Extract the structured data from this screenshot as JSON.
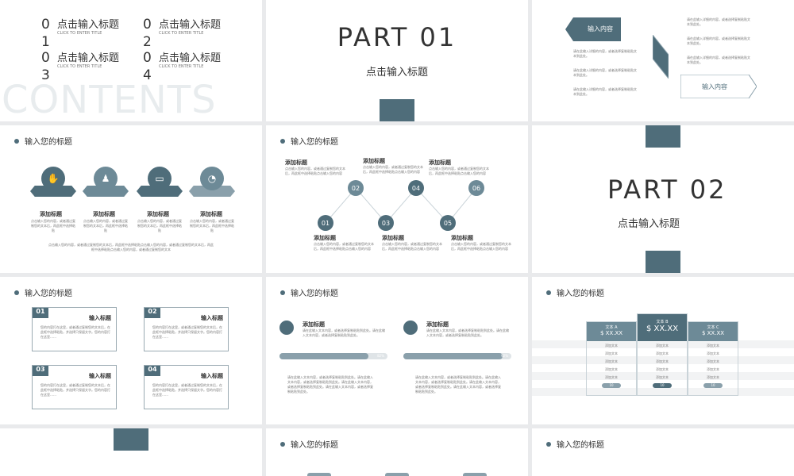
{
  "colors": {
    "accent": "#4f6d7a",
    "accent_light": "#8aa0ab",
    "bg": "#e9eaec"
  },
  "slide1": {
    "items": [
      {
        "num": "01",
        "title": "点击输入标题",
        "sub": "CLICK TO ENTER TITLE"
      },
      {
        "num": "02",
        "title": "点击输入标题",
        "sub": "CLICK TO ENTER TITLE"
      },
      {
        "num": "03",
        "title": "点击输入标题",
        "sub": "CLICK TO ENTER TITLE"
      },
      {
        "num": "04",
        "title": "点击输入标题",
        "sub": "CLICK TO ENTER TITLE"
      }
    ],
    "watermark": "CONTENTS"
  },
  "slide2": {
    "part": "PART 01",
    "title": "点击输入标题"
  },
  "slide3": {
    "left_label": "输入内容",
    "right_label": "输入内容",
    "bullet": "请在此输入详细的内容，或者选择复制粘贴文本到此处。"
  },
  "slide4": {
    "header": "输入您的标题",
    "items": [
      {
        "title": "添加标题",
        "text": "点击输入您的内容，或者通过复制您的文本后，再此框中选择粘贴"
      },
      {
        "title": "添加标题",
        "text": "点击输入您的内容，或者通过复制您的文本后，再此框中选择粘贴"
      },
      {
        "title": "添加标题",
        "text": "点击输入您的内容，或者通过复制您的文本后，再此框中选择粘贴"
      },
      {
        "title": "添加标题",
        "text": "点击输入您的内容，或者通过复制您的文本后，再此框中选择粘贴"
      }
    ],
    "footer": "点击输入您的内容，或者通过复制您的文本后，再此框中选择粘贴点击输入您的内容，或者通过复制您的文本后，再此框中选择粘贴点击输入您的内容，或者通过复制您的文本"
  },
  "slide5": {
    "header": "输入您的标题",
    "nodes": [
      "01",
      "02",
      "03",
      "04",
      "05",
      "06"
    ],
    "item_title": "添加标题",
    "item_text": "点击输入您的内容，或者通过复制您的文本后，再此框中选择粘贴点击输入您的内容"
  },
  "slide6": {
    "part": "PART 02",
    "title": "点击输入标题"
  },
  "slide7": {
    "header": "输入您的标题",
    "boxes": [
      {
        "num": "01",
        "title": "输入标题",
        "text": "您的内容打在这里，或者通过复制您的文本后，在此框中选择粘贴，并选择只保留文字。您的内容打在这里……"
      },
      {
        "num": "02",
        "title": "输入标题",
        "text": "您的内容打在这里，或者通过复制您的文本后，在此框中选择粘贴，并选择只保留文字。您的内容打在这里……"
      },
      {
        "num": "03",
        "title": "输入标题",
        "text": "您的内容打在这里，或者通过复制您的文本后，在此框中选择粘贴，并选择只保留文字。您的内容打在这里……"
      },
      {
        "num": "04",
        "title": "输入标题",
        "text": "您的内容打在这里，或者通过复制您的文本后，在此框中选择粘贴，并选择只保留文字。您的内容打在这里……"
      }
    ]
  },
  "slide8": {
    "header": "输入您的标题",
    "blocks": [
      {
        "title": "添加标题",
        "text": "请在此输入文本内容，或者选择复制粘贴到此处。请在此输入文本内容，或者选择复制粘贴到此处。",
        "progress": 0.82,
        "progress_label": "82%"
      },
      {
        "title": "添加标题",
        "text": "请在此输入文本内容，或者选择复制粘贴到此处。请在此输入文本内容，或者选择复制粘贴到此处。",
        "progress": 0.92,
        "progress_label": "92%"
      }
    ],
    "para": "请在此输入文本内容，或者选择复制粘贴到此处。请在此输入文本内容，或者选择复制粘贴到此处。请在此输入文本内容，或者选择复制粘贴到此处。请在此输入文本内容，或者选择复制粘贴到此处。"
  },
  "slide9": {
    "header": "输入您的标题",
    "cols": [
      {
        "name": "文本 A",
        "price": "$ XX.XX"
      },
      {
        "name": "文本 B",
        "price": "$ XX.XX"
      },
      {
        "name": "文本 C",
        "price": "$ XX.XX"
      }
    ],
    "row_text": "添加文本",
    "btn": "10"
  },
  "slide11": {
    "header": "输入您的标题"
  },
  "slide12": {
    "header": "输入您的标题"
  }
}
